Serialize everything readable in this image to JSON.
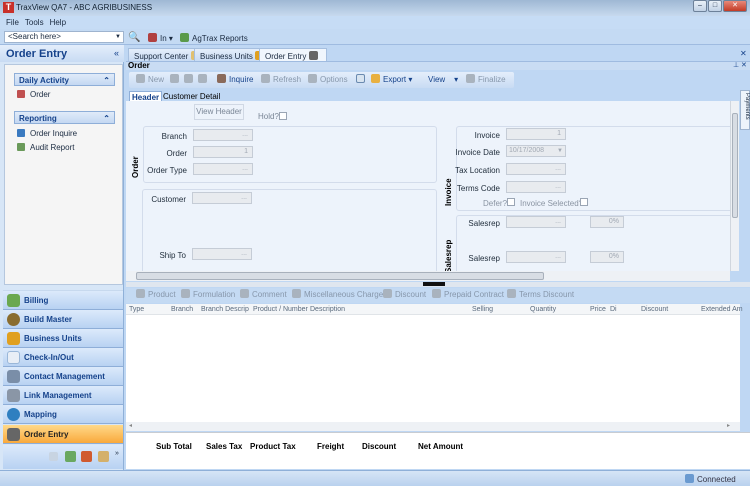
{
  "window": {
    "title": "TraxView QA7 - ABC AGRIBUSINESS",
    "logo": "T"
  },
  "menu": [
    "File",
    "Tools",
    "Help"
  ],
  "toolbar": {
    "search_placeholder": "<Search here>",
    "in_label": "In",
    "reports_label": "AgTrax Reports"
  },
  "sidebar": {
    "title": "Order Entry",
    "collapse": "«",
    "groups": [
      {
        "label": "Daily Activity",
        "items": [
          "Order"
        ]
      },
      {
        "label": "Reporting",
        "items": [
          "Order Inquire",
          "Audit Report"
        ]
      }
    ],
    "nav": [
      "Billing",
      "Build Master",
      "Business Units",
      "Check-In/Out",
      "Contact Management",
      "Link Management",
      "Mapping",
      "Order Entry"
    ],
    "nav_colors": [
      "#6aa84f",
      "#8a6d2f",
      "#e0a020",
      "#9ab7d8",
      "#7a8ea8",
      "#8a96a6",
      "#2f7fc0",
      "#666"
    ]
  },
  "tabs": [
    "Support Center",
    "Business Units",
    "Order Entry"
  ],
  "pane_title": "Order",
  "actions": {
    "new": "New",
    "inquire": "Inquire",
    "refresh": "Refresh",
    "options": "Options",
    "export": "Export",
    "view": "View",
    "finalize": "Finalize"
  },
  "subtabs": [
    "Header",
    "Customer Detail"
  ],
  "side_tab": "Payments",
  "form": {
    "view_header": "View Header",
    "hold": "Hold?",
    "order_group": "Order",
    "branch": "Branch",
    "order": "Order",
    "order_value": "1",
    "order_type": "Order Type",
    "customer": "Customer",
    "ship_to": "Ship To",
    "invoice_group": "Invoice",
    "invoice": "Invoice",
    "invoice_value": "1",
    "invoice_date": "Invoice Date",
    "invoice_date_value": "10/17/2008",
    "tax_location": "Tax Location",
    "terms_code": "Terms Code",
    "defer": "Defer?",
    "invoice_selected": "Invoice Selected?",
    "salesrep_group": "Salesrep",
    "salesrep": "Salesrep",
    "salesrep_pct": "0%",
    "ellipsis": "..."
  },
  "line_actions": [
    "Product",
    "Formulation",
    "Comment",
    "Miscellaneous Charge",
    "Discount",
    "Prepaid Contract",
    "Terms Discount"
  ],
  "grid_columns": [
    "Type",
    "Branch",
    "Branch Descrip",
    "Product / Number",
    "Description",
    "Selling",
    "Quantity",
    "Price",
    "Di",
    "Discount",
    "Extended Am"
  ],
  "totals": [
    "Sub Total",
    "Sales Tax",
    "Product Tax",
    "Freight",
    "Discount",
    "Net Amount"
  ],
  "status": "Connected"
}
